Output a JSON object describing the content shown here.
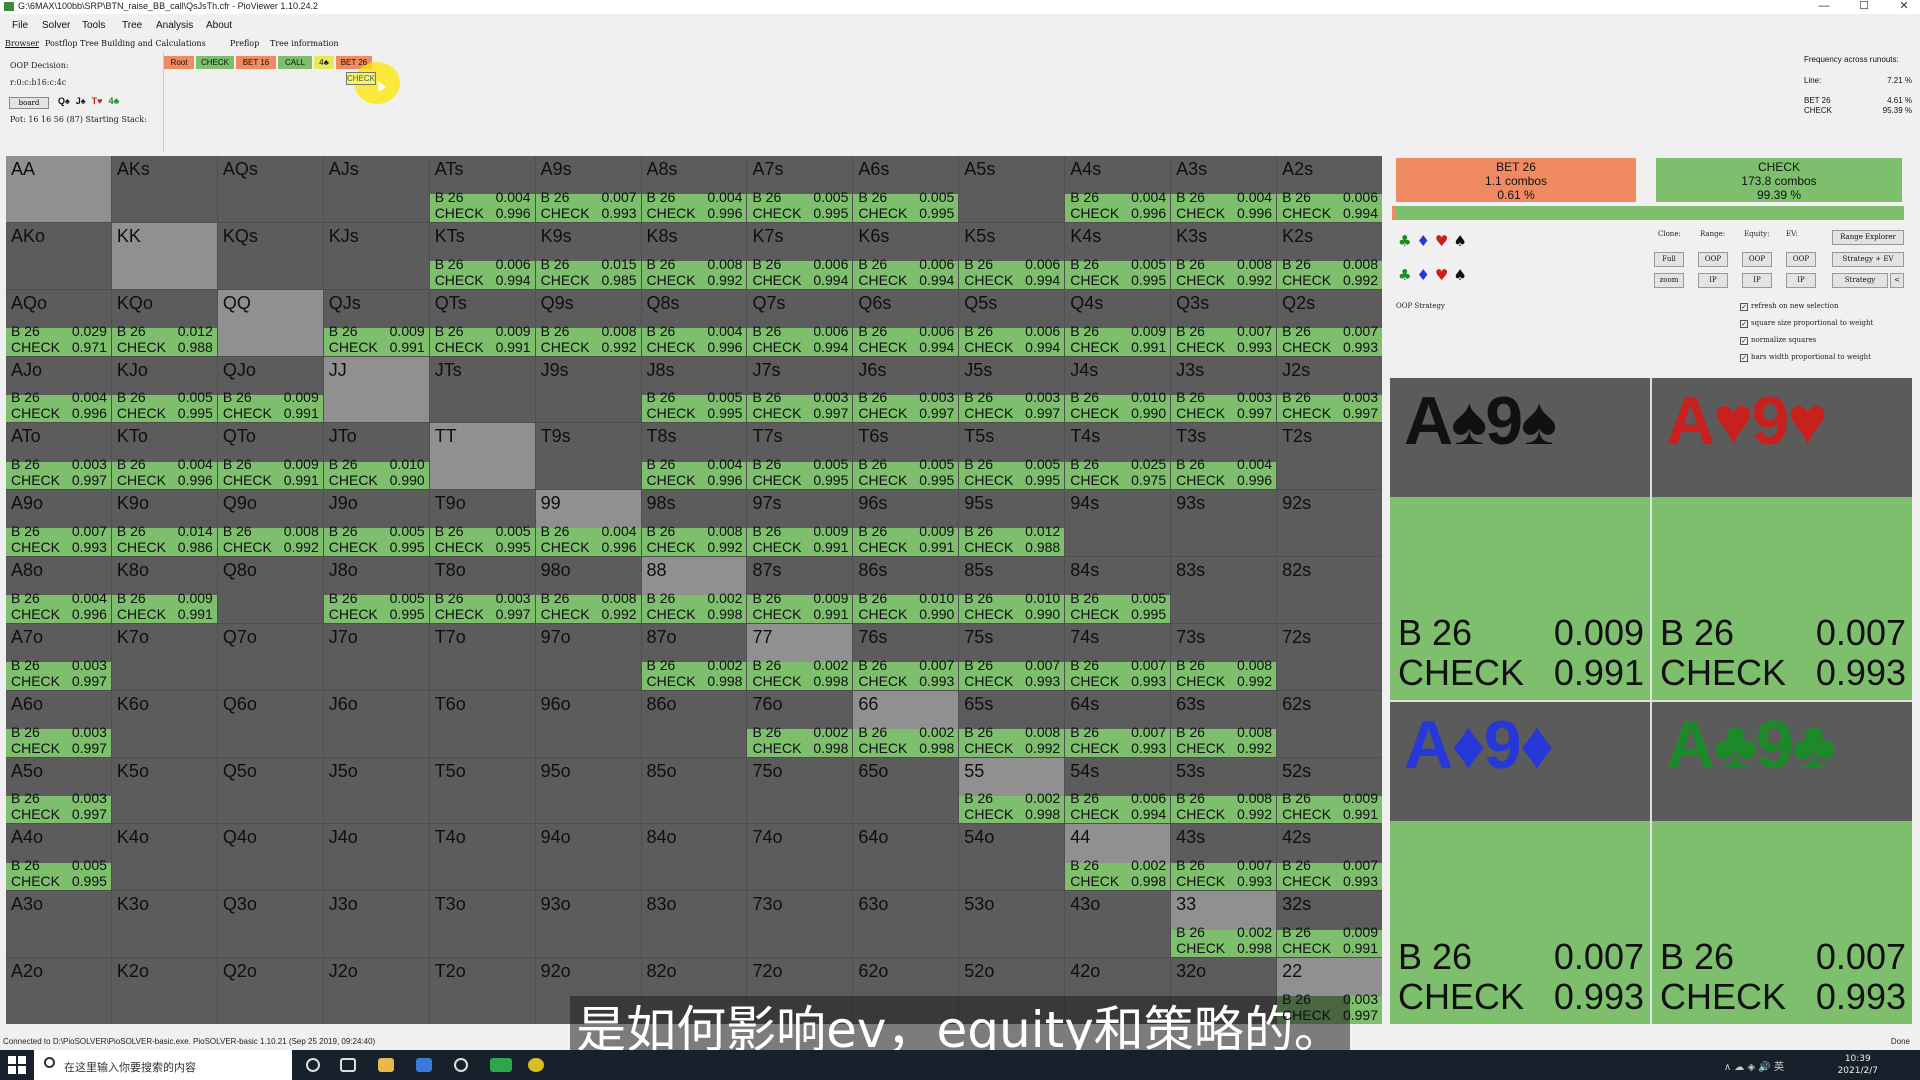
{
  "window": {
    "title": "G:\\6MAX\\100bb\\SRP\\BTN_raise_BB_call\\QsJsTh.cfr - PioViewer 1.10.24.2",
    "controls": [
      "—",
      "☐",
      "✕"
    ]
  },
  "menu": [
    "File",
    "Solver",
    "Tools",
    "Tree",
    "Analysis",
    "About"
  ],
  "tabs": [
    "Browser",
    "Postflop Tree Building and Calculations",
    "Preflop",
    "Tree information"
  ],
  "decision": {
    "label": "OOP Decision:",
    "line": "r:0:c:b16:c:4c",
    "board_button": "board",
    "board_cards": [
      {
        "c": "Q♠",
        "color": "#111"
      },
      {
        "c": "J♠",
        "color": "#111"
      },
      {
        "c": "T♥",
        "color": "#c8201c"
      },
      {
        "c": "4♣",
        "color": "#1d8a2a"
      }
    ],
    "pot": "Pot: 16 16 56 (87) Starting Stack:"
  },
  "breadcrumb": [
    {
      "label": "Root",
      "color": "#f08a62"
    },
    {
      "label": "CHECK",
      "color": "#7dbf6d"
    },
    {
      "label": "BET 16",
      "color": "#f08a62"
    },
    {
      "label": "CALL",
      "color": "#7dbf6d"
    },
    {
      "label": "4♣",
      "color": "#e8e85a"
    },
    {
      "label": "BET 26",
      "color": "#f08a62"
    }
  ],
  "tooltip": "CHECK",
  "freq": {
    "title": "Frequency across runouts:",
    "line_label": "Line:",
    "line_value": "7.21 %",
    "bet_label": "BET 26",
    "bet_value": "4.61 %",
    "check_label": "CHECK",
    "check_value": "95.39 %"
  },
  "summary": {
    "bet": {
      "label": "BET 26",
      "combos": "1.1 combos",
      "pct": "0.61 %",
      "color": "#f08a62"
    },
    "check": {
      "label": "CHECK",
      "combos": "173.8 combos",
      "pct": "99.39 %",
      "color": "#7dbf6d"
    },
    "bet_share": 0.0061
  },
  "controls": {
    "clone": "Clone:",
    "range": "Range:",
    "equity": "Equity:",
    "ev": "EV:",
    "range_explorer": "Range Explorer",
    "full": "Full",
    "zoom": "zoom",
    "oop": "OOP",
    "ip": "IP",
    "strategy_ev": "Strategy + EV",
    "strategy": "Strategy",
    "back": "<",
    "oop_strategy": "OOP Strategy",
    "checkboxes": [
      "refresh on new selection",
      "square size proportional to weight",
      "normalize squares",
      "bars width proportional to weight"
    ]
  },
  "hand_labels": {
    "bet": "B 26",
    "check": "CHECK"
  },
  "grid": [
    [
      [
        "AA"
      ],
      [
        "AKs"
      ],
      [
        "AQs"
      ],
      [
        "AJs"
      ],
      [
        "ATs",
        "0.004",
        "0.996"
      ],
      [
        "A9s",
        "0.007",
        "0.993"
      ],
      [
        "A8s",
        "0.004",
        "0.996"
      ],
      [
        "A7s",
        "0.005",
        "0.995"
      ],
      [
        "A6s",
        "0.005",
        "0.995"
      ],
      [
        "A5s"
      ],
      [
        "A4s",
        "0.004",
        "0.996"
      ],
      [
        "A3s",
        "0.004",
        "0.996"
      ],
      [
        "A2s",
        "0.006",
        "0.994"
      ]
    ],
    [
      [
        "AKo"
      ],
      [
        "KK"
      ],
      [
        "KQs"
      ],
      [
        "KJs"
      ],
      [
        "KTs",
        "0.006",
        "0.994"
      ],
      [
        "K9s",
        "0.015",
        "0.985"
      ],
      [
        "K8s",
        "0.008",
        "0.992"
      ],
      [
        "K7s",
        "0.006",
        "0.994"
      ],
      [
        "K6s",
        "0.006",
        "0.994"
      ],
      [
        "K5s",
        "0.006",
        "0.994"
      ],
      [
        "K4s",
        "0.005",
        "0.995"
      ],
      [
        "K3s",
        "0.008",
        "0.992"
      ],
      [
        "K2s",
        "0.008",
        "0.992"
      ]
    ],
    [
      [
        "AQo",
        "0.029",
        "0.971"
      ],
      [
        "KQo",
        "0.012",
        "0.988"
      ],
      [
        "QQ"
      ],
      [
        "QJs",
        "0.009",
        "0.991"
      ],
      [
        "QTs",
        "0.009",
        "0.991"
      ],
      [
        "Q9s",
        "0.008",
        "0.992"
      ],
      [
        "Q8s",
        "0.004",
        "0.996"
      ],
      [
        "Q7s",
        "0.006",
        "0.994"
      ],
      [
        "Q6s",
        "0.006",
        "0.994"
      ],
      [
        "Q5s",
        "0.006",
        "0.994"
      ],
      [
        "Q4s",
        "0.009",
        "0.991"
      ],
      [
        "Q3s",
        "0.007",
        "0.993"
      ],
      [
        "Q2s",
        "0.007",
        "0.993"
      ]
    ],
    [
      [
        "AJo",
        "0.004",
        "0.996"
      ],
      [
        "KJo",
        "0.005",
        "0.995"
      ],
      [
        "QJo",
        "0.009",
        "0.991"
      ],
      [
        "JJ"
      ],
      [
        "JTs"
      ],
      [
        "J9s"
      ],
      [
        "J8s",
        "0.005",
        "0.995"
      ],
      [
        "J7s",
        "0.003",
        "0.997"
      ],
      [
        "J6s",
        "0.003",
        "0.997"
      ],
      [
        "J5s",
        "0.003",
        "0.997"
      ],
      [
        "J4s",
        "0.010",
        "0.990"
      ],
      [
        "J3s",
        "0.003",
        "0.997"
      ],
      [
        "J2s",
        "0.003",
        "0.997"
      ]
    ],
    [
      [
        "ATo",
        "0.003",
        "0.997"
      ],
      [
        "KTo",
        "0.004",
        "0.996"
      ],
      [
        "QTo",
        "0.009",
        "0.991"
      ],
      [
        "JTo",
        "0.010",
        "0.990"
      ],
      [
        "TT"
      ],
      [
        "T9s"
      ],
      [
        "T8s",
        "0.004",
        "0.996"
      ],
      [
        "T7s",
        "0.005",
        "0.995"
      ],
      [
        "T6s",
        "0.005",
        "0.995"
      ],
      [
        "T5s",
        "0.005",
        "0.995"
      ],
      [
        "T4s",
        "0.025",
        "0.975"
      ],
      [
        "T3s",
        "0.004",
        "0.996"
      ],
      [
        "T2s"
      ]
    ],
    [
      [
        "A9o",
        "0.007",
        "0.993"
      ],
      [
        "K9o",
        "0.014",
        "0.986"
      ],
      [
        "Q9o",
        "0.008",
        "0.992"
      ],
      [
        "J9o",
        "0.005",
        "0.995"
      ],
      [
        "T9o",
        "0.005",
        "0.995"
      ],
      [
        "99",
        "0.004",
        "0.996"
      ],
      [
        "98s",
        "0.008",
        "0.992"
      ],
      [
        "97s",
        "0.009",
        "0.991"
      ],
      [
        "96s",
        "0.009",
        "0.991"
      ],
      [
        "95s",
        "0.012",
        "0.988"
      ],
      [
        "94s"
      ],
      [
        "93s"
      ],
      [
        "92s"
      ]
    ],
    [
      [
        "A8o",
        "0.004",
        "0.996"
      ],
      [
        "K8o",
        "0.009",
        "0.991"
      ],
      [
        "Q8o"
      ],
      [
        "J8o",
        "0.005",
        "0.995"
      ],
      [
        "T8o",
        "0.003",
        "0.997"
      ],
      [
        "98o",
        "0.008",
        "0.992"
      ],
      [
        "88",
        "0.002",
        "0.998"
      ],
      [
        "87s",
        "0.009",
        "0.991"
      ],
      [
        "86s",
        "0.010",
        "0.990"
      ],
      [
        "85s",
        "0.010",
        "0.990"
      ],
      [
        "84s",
        "0.005",
        "0.995"
      ],
      [
        "83s"
      ],
      [
        "82s"
      ]
    ],
    [
      [
        "A7o",
        "0.003",
        "0.997"
      ],
      [
        "K7o"
      ],
      [
        "Q7o"
      ],
      [
        "J7o"
      ],
      [
        "T7o"
      ],
      [
        "97o"
      ],
      [
        "87o",
        "0.002",
        "0.998"
      ],
      [
        "77",
        "0.002",
        "0.998"
      ],
      [
        "76s",
        "0.007",
        "0.993"
      ],
      [
        "75s",
        "0.007",
        "0.993"
      ],
      [
        "74s",
        "0.007",
        "0.993"
      ],
      [
        "73s",
        "0.008",
        "0.992"
      ],
      [
        "72s"
      ]
    ],
    [
      [
        "A6o",
        "0.003",
        "0.997"
      ],
      [
        "K6o"
      ],
      [
        "Q6o"
      ],
      [
        "J6o"
      ],
      [
        "T6o"
      ],
      [
        "96o"
      ],
      [
        "86o"
      ],
      [
        "76o",
        "0.002",
        "0.998"
      ],
      [
        "66",
        "0.002",
        "0.998"
      ],
      [
        "65s",
        "0.008",
        "0.992"
      ],
      [
        "64s",
        "0.007",
        "0.993"
      ],
      [
        "63s",
        "0.008",
        "0.992"
      ],
      [
        "62s"
      ]
    ],
    [
      [
        "A5o",
        "0.003",
        "0.997"
      ],
      [
        "K5o"
      ],
      [
        "Q5o"
      ],
      [
        "J5o"
      ],
      [
        "T5o"
      ],
      [
        "95o"
      ],
      [
        "85o"
      ],
      [
        "75o"
      ],
      [
        "65o"
      ],
      [
        "55",
        "0.002",
        "0.998"
      ],
      [
        "54s",
        "0.006",
        "0.994"
      ],
      [
        "53s",
        "0.008",
        "0.992"
      ],
      [
        "52s",
        "0.009",
        "0.991"
      ]
    ],
    [
      [
        "A4o",
        "0.005",
        "0.995"
      ],
      [
        "K4o"
      ],
      [
        "Q4o"
      ],
      [
        "J4o"
      ],
      [
        "T4o"
      ],
      [
        "94o"
      ],
      [
        "84o"
      ],
      [
        "74o"
      ],
      [
        "64o"
      ],
      [
        "54o"
      ],
      [
        "44",
        "0.002",
        "0.998"
      ],
      [
        "43s",
        "0.007",
        "0.993"
      ],
      [
        "42s",
        "0.007",
        "0.993"
      ]
    ],
    [
      [
        "A3o"
      ],
      [
        "K3o"
      ],
      [
        "Q3o"
      ],
      [
        "J3o"
      ],
      [
        "T3o"
      ],
      [
        "93o"
      ],
      [
        "83o"
      ],
      [
        "73o"
      ],
      [
        "63o"
      ],
      [
        "53o"
      ],
      [
        "43o"
      ],
      [
        "33",
        "0.002",
        "0.998"
      ],
      [
        "32s",
        "0.009",
        "0.991"
      ]
    ],
    [
      [
        "A2o"
      ],
      [
        "K2o"
      ],
      [
        "Q2o"
      ],
      [
        "J2o"
      ],
      [
        "T2o"
      ],
      [
        "92o"
      ],
      [
        "82o"
      ],
      [
        "72o"
      ],
      [
        "62o"
      ],
      [
        "52o"
      ],
      [
        "42o"
      ],
      [
        "32o"
      ],
      [
        "22",
        "0.003",
        "0.997"
      ]
    ]
  ],
  "combos": [
    {
      "title": "A♠9♠",
      "color": "#111111",
      "bet": "0.009",
      "check": "0.991"
    },
    {
      "title": "A♥9♥",
      "color": "#c8201c",
      "bet": "0.007",
      "check": "0.993"
    },
    {
      "title": "A♦9♦",
      "color": "#2638d8",
      "bet": "0.007",
      "check": "0.993"
    },
    {
      "title": "A♣9♣",
      "color": "#1d8a2a",
      "bet": "0.007",
      "check": "0.993"
    }
  ],
  "subtitle": "是如何影响ev，equity和策略的。",
  "status": {
    "left": "Connected to D:\\PioSOLVER\\PioSOLVER-basic.exe. PioSOLVER-basic 1.10.21 (Sep 25 2019, 09:24:40)",
    "right": "Done"
  },
  "taskbar": {
    "search_placeholder": "在这里输入你要搜索的内容",
    "time": "10:39",
    "date": "2021/2/7",
    "tray": "∧ ☁ ◈ 🔊 英"
  }
}
